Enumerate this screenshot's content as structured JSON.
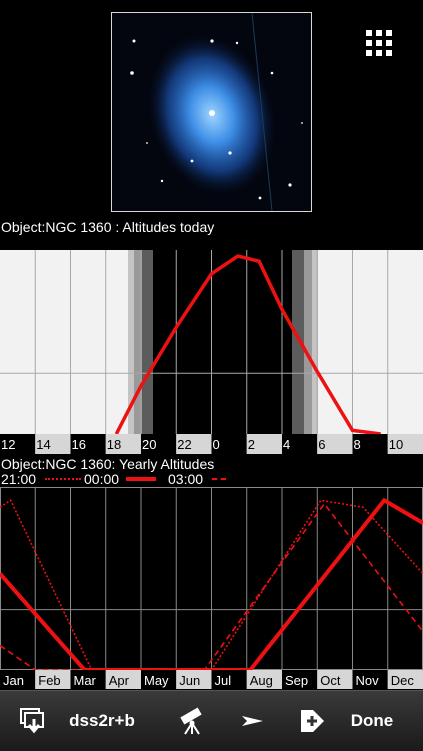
{
  "header": {
    "grid_icon": "grid-menu-icon"
  },
  "daily": {
    "caption": "Object:NGC 1360 : Altitudes today",
    "hour_labels": [
      "12",
      "14",
      "16",
      "18",
      "20",
      "22",
      "0",
      "2",
      "4",
      "6",
      "8",
      "10"
    ]
  },
  "yearly": {
    "caption": "Object:NGC 1360: Yearly Altitudes",
    "legend": [
      {
        "label": "21:00",
        "style": "dotted"
      },
      {
        "label": "00:00",
        "style": "solid"
      },
      {
        "label": "03:00",
        "style": "dashed"
      }
    ],
    "month_labels": [
      "Jan",
      "Feb",
      "Mar",
      "Apr",
      "May",
      "Jun",
      "Jul",
      "Aug",
      "Sep",
      "Oct",
      "Nov",
      "Dec"
    ]
  },
  "chart_data": [
    {
      "type": "line",
      "title": "Object:NGC 1360 : Altitudes today",
      "x_tick_labels": [
        "12",
        "14",
        "16",
        "18",
        "20",
        "22",
        "0",
        "2",
        "4",
        "6",
        "8",
        "10"
      ],
      "series": [
        {
          "values_hour": [
            18.6,
            20,
            22,
            0,
            1.5,
            2.7,
            4,
            6,
            8,
            9.6
          ],
          "values_altitude_fraction": [
            0,
            0.27,
            0.6,
            0.9,
            1.0,
            0.97,
            0.7,
            0.35,
            0.02,
            0
          ]
        }
      ],
      "night_shading": true,
      "grid": true
    },
    {
      "type": "line",
      "title": "Object:NGC 1360: Yearly Altitudes",
      "x_tick_labels": [
        "Jan",
        "Feb",
        "Mar",
        "Apr",
        "May",
        "Jun",
        "Jul",
        "Aug",
        "Sep",
        "Oct",
        "Nov",
        "Dec"
      ],
      "series": [
        {
          "name": "21:00",
          "style": "dotted",
          "month": [
            0,
            0.3,
            2.6,
            6.0,
            9.1,
            10.3,
            12.0
          ],
          "altitude_fraction": [
            0.93,
            0.97,
            0,
            0,
            0.97,
            0.93,
            0.55
          ]
        },
        {
          "name": "00:00",
          "style": "solid",
          "month": [
            0,
            2.4,
            7.1,
            10.9,
            12.0
          ],
          "altitude_fraction": [
            0.55,
            0,
            0,
            0.97,
            0.84
          ]
        },
        {
          "name": "03:00",
          "style": "dashed",
          "month": [
            0,
            1.0,
            5.8,
            9.2,
            12.0
          ],
          "altitude_fraction": [
            0.14,
            0,
            0,
            0.95,
            0.22
          ]
        }
      ],
      "grid": true
    }
  ],
  "toolbar": {
    "download_icon": "download-icon",
    "survey_label": "dss2r+b",
    "telescope_icon": "telescope-icon",
    "goto_icon": "arrow-icon",
    "add_icon": "add-tag-icon",
    "done_label": "Done"
  }
}
